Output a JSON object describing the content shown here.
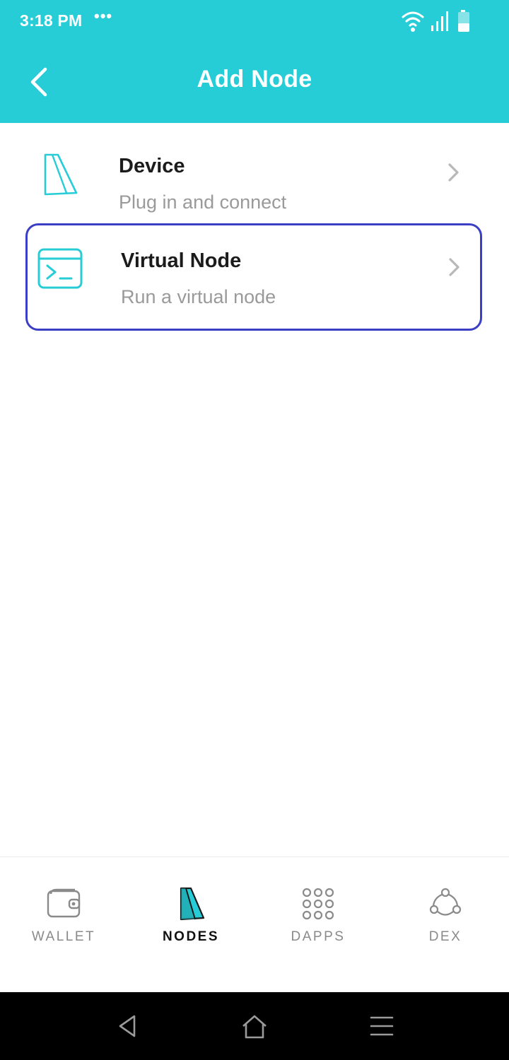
{
  "status_bar": {
    "time": "3:18 PM",
    "dots": "•••"
  },
  "header": {
    "title": "Add Node"
  },
  "items": [
    {
      "title": "Device",
      "subtitle": "Plug in and connect",
      "icon": "device-icon"
    },
    {
      "title": "Virtual Node",
      "subtitle": "Run a virtual node",
      "icon": "terminal-icon"
    }
  ],
  "bottom_nav": [
    {
      "label": "WALLET",
      "icon": "wallet-icon",
      "active": false
    },
    {
      "label": "NODES",
      "icon": "nodes-icon",
      "active": true
    },
    {
      "label": "DAPPS",
      "icon": "grid-icon",
      "active": false
    },
    {
      "label": "DEX",
      "icon": "dex-icon",
      "active": false
    }
  ],
  "colors": {
    "accent": "#26ccd6",
    "selection_border": "#3b3fc6"
  }
}
